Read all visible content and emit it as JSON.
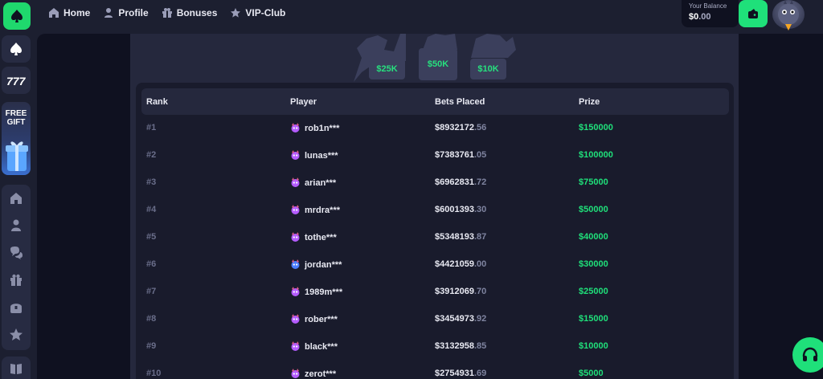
{
  "nav": {
    "home": "Home",
    "profile": "Profile",
    "bonuses": "Bonuses",
    "vip": "VIP-Club"
  },
  "balance": {
    "label": "Your Balance",
    "dollars": "$0",
    "cents": ".00"
  },
  "sidebar": {
    "gift_line1": "FREE",
    "gift_line2": "GIFT"
  },
  "podium": {
    "left": "$25K",
    "center": "$50K",
    "right": "$10K"
  },
  "table": {
    "headers": {
      "rank": "Rank",
      "player": "Player",
      "bets": "Bets Placed",
      "prize": "Prize"
    },
    "rows": [
      {
        "rank": "#1",
        "player": "rob1n***",
        "bets": "$8932172",
        "cents": ".56",
        "prize": "$150000"
      },
      {
        "rank": "#2",
        "player": "lunas***",
        "bets": "$7383761",
        "cents": ".05",
        "prize": "$100000"
      },
      {
        "rank": "#3",
        "player": "arian***",
        "bets": "$6962831",
        "cents": ".72",
        "prize": "$75000"
      },
      {
        "rank": "#4",
        "player": "mrdra***",
        "bets": "$6001393",
        "cents": ".30",
        "prize": "$50000"
      },
      {
        "rank": "#5",
        "player": "tothe***",
        "bets": "$5348193",
        "cents": ".87",
        "prize": "$40000"
      },
      {
        "rank": "#6",
        "player": "jordan***",
        "bets": "$4421059",
        "cents": ".00",
        "prize": "$30000"
      },
      {
        "rank": "#7",
        "player": "1989m***",
        "bets": "$3912069",
        "cents": ".70",
        "prize": "$25000"
      },
      {
        "rank": "#8",
        "player": "rober***",
        "bets": "$3454973",
        "cents": ".92",
        "prize": "$15000"
      },
      {
        "rank": "#9",
        "player": "black***",
        "bets": "$3132958",
        "cents": ".85",
        "prize": "$10000"
      },
      {
        "rank": "#10",
        "player": "zerot***",
        "bets": "$2754931",
        "cents": ".69",
        "prize": "$5000"
      }
    ]
  },
  "colors": {
    "accent": "#1fe07a",
    "background": "#1c1f30",
    "panel": "#25283d",
    "table": "#191b2c"
  }
}
